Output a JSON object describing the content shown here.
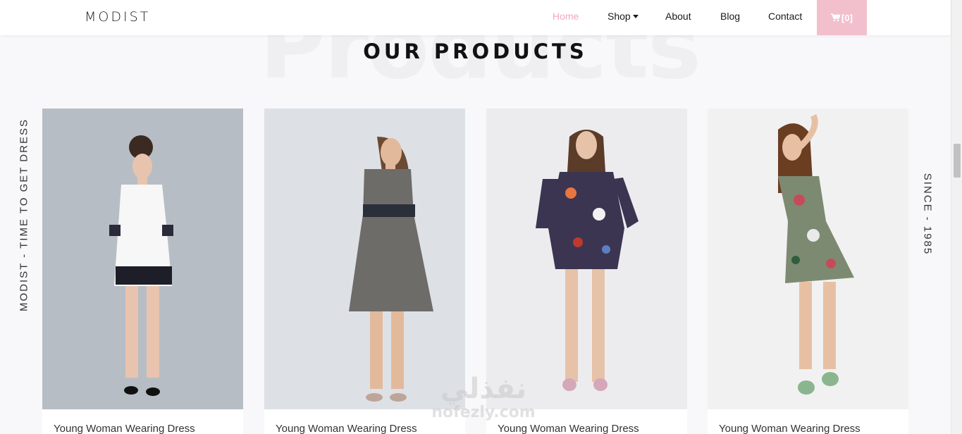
{
  "header": {
    "brand": "MODIST",
    "nav": [
      {
        "label": "Home",
        "active": true
      },
      {
        "label": "Shop",
        "dropdown": true
      },
      {
        "label": "About"
      },
      {
        "label": "Blog"
      },
      {
        "label": "Contact"
      }
    ],
    "cart_label": "[0]",
    "cart_icon": "shopping-cart-icon"
  },
  "section": {
    "background_word": "Products",
    "title": "OUR PRODUCTS",
    "side_left": "MODIST - TIME TO GET DRESS",
    "side_right": "SINCE - 1985"
  },
  "products": [
    {
      "title": "Young Woman Wearing Dress",
      "dress_color": "#ffffff",
      "backdrop": "#aeb4bc"
    },
    {
      "title": "Young Woman Wearing Dress",
      "dress_color": "#6e6c69",
      "backdrop": "#dde1e6"
    },
    {
      "title": "Young Woman Wearing Dress",
      "dress_color": "#3b3552",
      "backdrop": "#ececef"
    },
    {
      "title": "Young Woman Wearing Dress",
      "dress_color": "#7d8a72",
      "backdrop": "#f1f1f2"
    }
  ],
  "watermark": {
    "arabic": "نفذلي",
    "latin": "nofezly.com"
  },
  "colors": {
    "accent": "#f2a7bf",
    "cart_bg": "#f2bfcd",
    "page_bg": "#f8f8fa"
  }
}
